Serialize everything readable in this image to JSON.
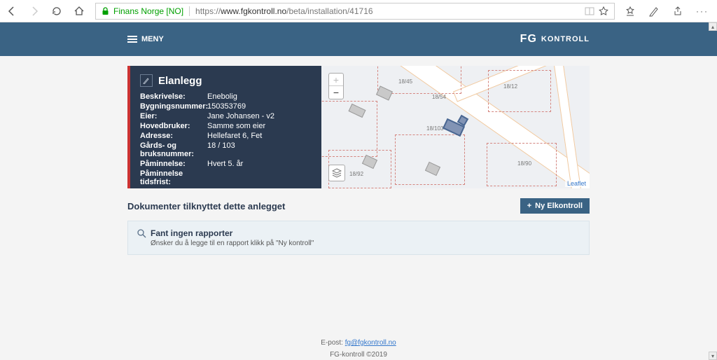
{
  "browser": {
    "site_name": "Finans Norge [NO]",
    "url_prefix": "https://",
    "url_domain": "www.fgkontroll.no",
    "url_path": "/beta/installation/41716"
  },
  "header": {
    "menu_label": "MENY",
    "logo_text": "FG",
    "logo_sub": "KONTROLL"
  },
  "panel": {
    "title": "Elanlegg",
    "fields": [
      {
        "label": "Beskrivelse:",
        "value": "Enebolig"
      },
      {
        "label": "Bygningsnummer:",
        "value": "150353769"
      },
      {
        "label": "Eier:",
        "value": "Jane Johansen - v2"
      },
      {
        "label": "Hovedbruker:",
        "value": "Samme som eier"
      },
      {
        "label": "Adresse:",
        "value": "Hellefaret 6, Fet"
      },
      {
        "label": "Gårds- og bruksnummer:",
        "value": "18 / 103"
      },
      {
        "label": "Påminnelse:",
        "value": "Hvert 5. år"
      },
      {
        "label": "Påminnelse tidsfrist:",
        "value": ""
      }
    ]
  },
  "map": {
    "attribution": "Leaflet",
    "lot_labels": [
      "18/45",
      "18/54",
      "18/12",
      "18/103",
      "18/90",
      "18/92"
    ]
  },
  "documents": {
    "heading": "Dokumenter tilknyttet dette anlegget",
    "new_button": "Ny Elkontroll",
    "empty_title": "Fant ingen rapporter",
    "empty_subtitle": "Ønsker du å legge til en rapport klikk på \"Ny kontroll\""
  },
  "footer": {
    "email_label": "E-post: ",
    "email": "fg@fgkontroll.no",
    "copyright": "FG-kontroll ©2019"
  }
}
